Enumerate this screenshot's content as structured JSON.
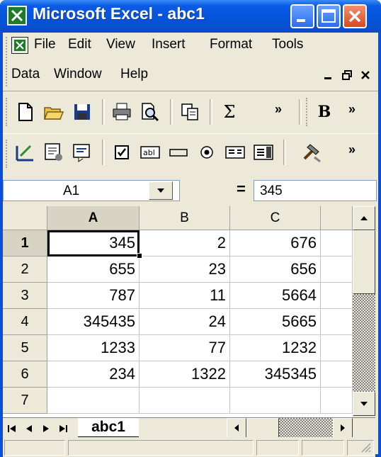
{
  "window": {
    "title": "Microsoft Excel - abc1"
  },
  "menu": {
    "row1": [
      "File",
      "Edit",
      "View",
      "Insert",
      "Format",
      "Tools"
    ],
    "row2": [
      "Data",
      "Window",
      "Help"
    ]
  },
  "formula_bar": {
    "name_box": "A1",
    "equals": "=",
    "formula": "345"
  },
  "columns": [
    "A",
    "B",
    "C"
  ],
  "rows": [
    {
      "num": "1",
      "cells": [
        "345",
        "2",
        "676"
      ]
    },
    {
      "num": "2",
      "cells": [
        "655",
        "23",
        "656"
      ]
    },
    {
      "num": "3",
      "cells": [
        "787",
        "11",
        "5664"
      ]
    },
    {
      "num": "4",
      "cells": [
        "345435",
        "24",
        "5665"
      ]
    },
    {
      "num": "5",
      "cells": [
        "1233",
        "77",
        "1232"
      ]
    },
    {
      "num": "6",
      "cells": [
        "234",
        "1322",
        "345345"
      ]
    },
    {
      "num": "7",
      "cells": [
        "",
        "",
        ""
      ]
    }
  ],
  "sheet_tab": "abc1",
  "toolbar": {
    "sum_symbol": "Σ",
    "bold_label": "B"
  },
  "colors": {
    "title_bar": "#0553d8",
    "chrome": "#ece9d8",
    "close_button": "#d84820"
  }
}
